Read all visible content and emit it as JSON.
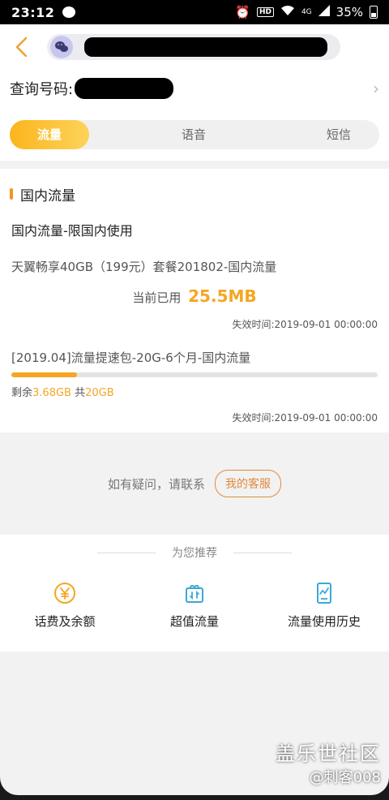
{
  "status_bar": {
    "time": "23:12",
    "hd_label": "HD",
    "network": "4G",
    "battery": "35%"
  },
  "header": {
    "back_icon": "chevron-left-icon",
    "contact_icon": "wechat-icon"
  },
  "query": {
    "label": "查询号码:"
  },
  "tabs": [
    {
      "label": "流量",
      "active": true
    },
    {
      "label": "语音",
      "active": false
    },
    {
      "label": "短信",
      "active": false
    }
  ],
  "section": {
    "title": "国内流量",
    "subtitle": "国内流量-限国内使用",
    "plan_name": "天翼畅享40GB（199元）套餐201802-国内流量",
    "used_label": "当前已用",
    "used_value": "25.5MB",
    "expire": "失效时间:2019-09-01 00:00:00",
    "package_name": "[2019.04]流量提速包-20G-6个月-国内流量",
    "remain_label": "剩余",
    "remain_value": "3.68GB",
    "total_label": "共",
    "total_value": "20GB",
    "progress_fraction": 0.18,
    "package_expire": "失效时间:2019-09-01 00:00:00"
  },
  "contact": {
    "text": "如有疑问，请联系",
    "button": "我的客服"
  },
  "recommend": {
    "title": "为您推荐",
    "items": [
      {
        "label": "话费及余额",
        "icon": "yuan-coin-icon"
      },
      {
        "label": "超值流量",
        "icon": "gift-box-icon"
      },
      {
        "label": "流量使用历史",
        "icon": "phone-chart-icon"
      }
    ]
  },
  "watermark": {
    "line1": "盖乐世社区",
    "line2": "@刺客008"
  },
  "colors": {
    "accent": "#f5a623",
    "tab_gradient_start": "#fbb51e",
    "tab_gradient_end": "#fdd35a",
    "service_border": "#e08a3c",
    "icon_blue": "#3aa8d8"
  }
}
